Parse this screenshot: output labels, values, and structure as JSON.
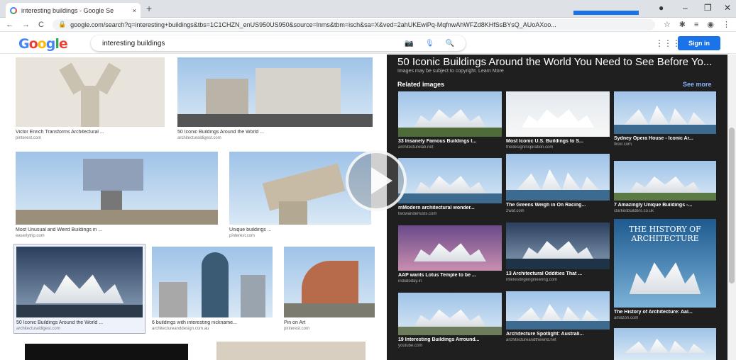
{
  "browser": {
    "tab_title": "interesting buildings - Google Se",
    "new_tab": "+",
    "close_tab": "×",
    "url": "google.com/search?q=interesting+buildings&tbs=1C1CHZN_enUS950US950&source=lnms&tbm=isch&sa=X&ved=2ahUKEwiPq-MqfnwAhWFZd8KHfSsBYsQ_AUoAXoo...",
    "nav": {
      "back": "←",
      "forward": "→",
      "reload": "C"
    }
  },
  "header": {
    "logo": "Google",
    "query": "interesting buildings",
    "signin_label": "Sign in"
  },
  "grid": [
    {
      "caption": "Victor Enrich Transforms Architectural ...",
      "source": "pinterest.com"
    },
    {
      "caption": "50 Iconic Buildings Around the World ...",
      "source": "architecturaldigest.com"
    },
    {
      "caption": "Most Unusual and Weird Buildings in ...",
      "source": "easerlytrip.com"
    },
    {
      "caption": "Unique buildings ...",
      "source": "pinterest.com"
    },
    {
      "caption": "50 Iconic Buildings Around the World ...",
      "source": "architecturaldigest.com"
    },
    {
      "caption": "6 buildings with interesting nickname...",
      "source": "architectureanddesign.com.au"
    },
    {
      "caption": "Pin on Art",
      "source": "pinterest.com"
    }
  ],
  "panel": {
    "title": "50 Iconic Buildings Around the World You Need to See Before Yo...",
    "subtitle": "Images may be subject to copyright. Learn More",
    "related_label": "Related images",
    "see_more": "See more",
    "related": [
      {
        "caption": "33 Insanely Famous Buildings t...",
        "source": "architecturelab.net"
      },
      {
        "caption": "Most Iconic U.S. Buildings to S...",
        "source": "thedesigninspiration.com"
      },
      {
        "caption": "Sydney Opera House - Iconic Ar...",
        "source": "flickr.com"
      },
      {
        "caption": "mModern architectural wonder...",
        "source": "twowanderlusts.com"
      },
      {
        "caption": "The Greens Weigh in On Racing...",
        "source": "2wat.com"
      },
      {
        "caption": "7 Amazingly Unique Buildings -...",
        "source": "clarkesbuilders.co.uk"
      },
      {
        "caption": "AAP wants Lotus Temple to be ...",
        "source": "indiatoday.in"
      },
      {
        "caption": "13 Architectural Oddities That ...",
        "source": "interestingengineering.com"
      },
      {
        "caption": "The History of Architecture: Aal...",
        "source": "amazon.com"
      },
      {
        "caption": "19 Interesting Buildings Arround...",
        "source": "youtube.com"
      },
      {
        "caption": "Architecture Spotlight: Australi...",
        "source": "architectureandthewrld.net"
      },
      {
        "caption": "",
        "source": ""
      }
    ],
    "book_title": "THE HISTORY OF ARCHITECTURE"
  }
}
